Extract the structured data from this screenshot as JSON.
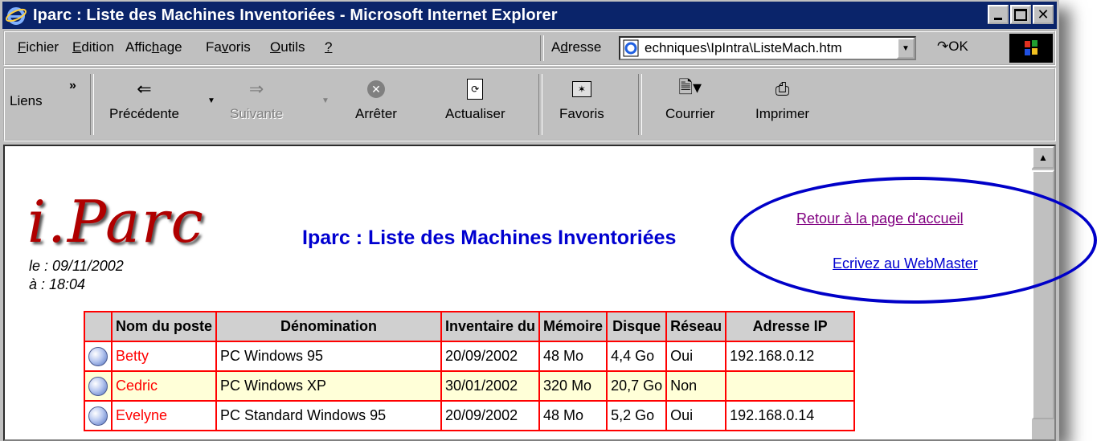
{
  "window": {
    "title": "Iparc : Liste des Machines Inventoriées - Microsoft Internet Explorer"
  },
  "menu": {
    "items": [
      {
        "pre": "",
        "u": "F",
        "post": "ichier"
      },
      {
        "pre": "",
        "u": "E",
        "post": "dition"
      },
      {
        "pre": "Affic",
        "u": "h",
        "post": "age"
      },
      {
        "pre": "Fa",
        "u": "v",
        "post": "oris"
      },
      {
        "pre": "",
        "u": "O",
        "post": "utils"
      },
      {
        "pre": "",
        "u": "?",
        "post": ""
      }
    ],
    "address_label_u": "d",
    "address_label": "Adresse",
    "address_value": "echniques\\IpIntra\\ListeMach.htm",
    "go_label": "OK"
  },
  "toolbar": {
    "links_label": "Liens",
    "back": "Précédente",
    "forward": "Suivante",
    "stop": "Arrêter",
    "refresh": "Actualiser",
    "favorites": "Favoris",
    "mail": "Courrier",
    "print": "Imprimer"
  },
  "page": {
    "logo": "i.Parc",
    "date_line": "le : 09/11/2002",
    "time_line": "à : 18:04",
    "title": "Iparc : Liste des Machines Inventoriées",
    "link_home": "Retour à la page d'accueil",
    "link_webmaster": "Ecrivez au WebMaster"
  },
  "table": {
    "headers": [
      "",
      "Nom du poste",
      "Dénomination",
      "Inventaire du",
      "Mémoire",
      "Disque",
      "Réseau",
      "Adresse IP"
    ],
    "rows": [
      [
        "Betty",
        "PC Windows 95",
        "20/09/2002",
        "48 Mo",
        "4,4 Go",
        "Oui",
        "192.168.0.12"
      ],
      [
        "Cedric",
        "PC Windows XP",
        "30/01/2002",
        "320 Mo",
        "20,7 Go",
        "Non",
        ""
      ],
      [
        "Evelyne",
        "PC Standard Windows 95",
        "20/09/2002",
        "48 Mo",
        "5,2 Go",
        "Oui",
        "192.168.0.14"
      ]
    ]
  },
  "colors": {
    "titlebar": "#0a246a",
    "link_visited": "#800080",
    "link": "#0000d0",
    "table_border": "#ff0000",
    "highlight_ellipse": "#0000c8"
  }
}
